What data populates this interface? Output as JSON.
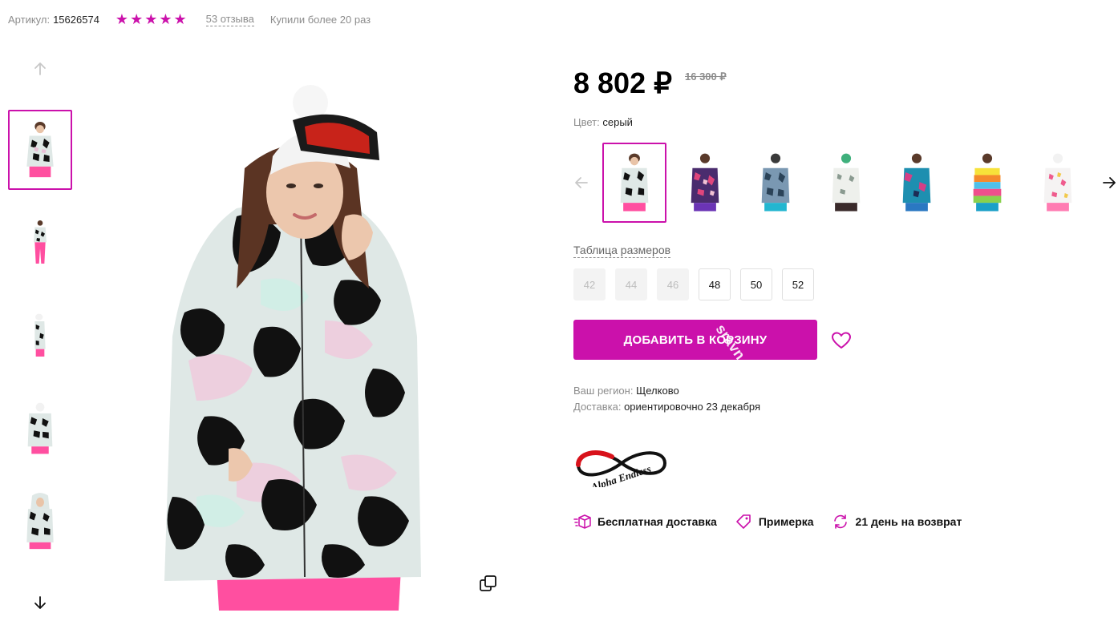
{
  "meta": {
    "sku_label": "Артикул:",
    "sku_value": "15626574",
    "rating": 5,
    "reviews": "53 отзыва",
    "bought": "Купили более 20 раз"
  },
  "colors": {
    "accent": "#cb11ab",
    "muted": "#8c8c8c"
  },
  "gallery": {
    "thumbnail_count": 5,
    "active_thumbnail": 1,
    "up_icon": "arrow-up-icon",
    "down_icon": "arrow-down-icon",
    "zoom_icon": "copy-icon"
  },
  "product": {
    "price": "8 802 ₽",
    "old_price": "16 300 ₽",
    "color_label": "Цвет:",
    "color_value": "серый",
    "variant_count": 7,
    "active_variant": 1
  },
  "sizes": {
    "table_link": "Таблица размеров",
    "items": [
      {
        "label": "42",
        "available": false
      },
      {
        "label": "44",
        "available": false
      },
      {
        "label": "46",
        "available": false
      },
      {
        "label": "48",
        "available": true
      },
      {
        "label": "50",
        "available": true
      },
      {
        "label": "52",
        "available": true
      }
    ]
  },
  "actions": {
    "add_to_cart": "ДОБАВИТЬ В КОРЗИНУ",
    "watermark": "sravn",
    "favorite_icon": "heart-icon"
  },
  "delivery": {
    "region_label": "Ваш регион:",
    "region_value": "Щелково",
    "delivery_label": "Доставка:",
    "delivery_value": "ориентировочно 23 декабря"
  },
  "brand": {
    "name": "Alpha Endless"
  },
  "features": [
    {
      "icon": "box-delivery-icon",
      "label": "Бесплатная доставка"
    },
    {
      "icon": "tag-icon",
      "label": "Примерка"
    },
    {
      "icon": "return-icon",
      "label": "21 день на возврат"
    }
  ]
}
